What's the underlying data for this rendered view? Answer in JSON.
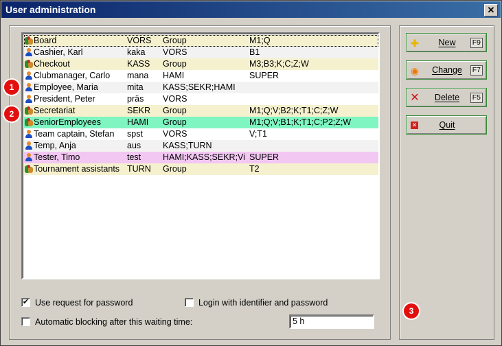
{
  "window": {
    "title": "User administration",
    "close_label": "✕"
  },
  "users": [
    {
      "name": "Board",
      "id": "VORS",
      "type": "Group",
      "rights": "M1;Q",
      "icon": "group-icon",
      "style": "group sel"
    },
    {
      "name": "Cashier, Karl",
      "id": "kaka",
      "type": "VORS",
      "rights": "B1",
      "icon": "person-icon",
      "style": "alt"
    },
    {
      "name": "Checkout",
      "id": "KASS",
      "type": "Group",
      "rights": "M3;B3;K;C;Z;W",
      "icon": "group-icon",
      "style": "group"
    },
    {
      "name": "Clubmanager, Carlo",
      "id": "mana",
      "type": "HAMI",
      "rights": "SUPER",
      "icon": "person-icon",
      "style": ""
    },
    {
      "name": "Employee, Maria",
      "id": "mita",
      "type": "KASS;SEKR;HAMI",
      "rights": "",
      "icon": "person-icon",
      "style": "alt"
    },
    {
      "name": "President, Peter",
      "id": "präs",
      "type": "VORS",
      "rights": "",
      "icon": "person-icon",
      "style": ""
    },
    {
      "name": "Secretariat",
      "id": "SEKR",
      "type": "Group",
      "rights": "M1;Q;V;B2;K;T1;C;Z;W",
      "icon": "group-icon",
      "style": "group"
    },
    {
      "name": "SeniorEmployees",
      "id": "HAMI",
      "type": "Group",
      "rights": "M1;Q;V;B1;K;T1;C;P2;Z;W",
      "icon": "group-icon",
      "style": "green"
    },
    {
      "name": "Team captain, Stefan",
      "id": "spst",
      "type": "VORS",
      "rights": "V;T1",
      "icon": "person-icon",
      "style": ""
    },
    {
      "name": "Temp, Anja",
      "id": "aus",
      "type": "KASS;TURN",
      "rights": "",
      "icon": "person-icon",
      "style": "alt"
    },
    {
      "name": "Tester, Timo",
      "id": "test",
      "type": "HAMI;KASS;SEKR;Vi",
      "rights": "SUPER",
      "icon": "person-icon",
      "style": "pink"
    },
    {
      "name": "Tournament assistants",
      "id": "TURN",
      "type": "Group",
      "rights": "T2",
      "icon": "group-icon",
      "style": "group"
    }
  ],
  "badges": [
    "1",
    "2",
    "3"
  ],
  "options": {
    "use_request_label": "Use request for password",
    "use_request_checked": true,
    "login_identifier_label": "Login with identifier and password",
    "login_identifier_checked": false,
    "auto_block_label": "Automatic blocking after this waiting time:",
    "auto_block_checked": false,
    "waiting_time": "5 h"
  },
  "buttons": [
    {
      "label": "New",
      "key": "F9",
      "icon": "new-icon"
    },
    {
      "label": "Change",
      "key": "F7",
      "icon": "change-icon"
    },
    {
      "label": "Delete",
      "key": "F5",
      "icon": "delete-icon"
    },
    {
      "label": "Quit",
      "key": "",
      "icon": "quit-icon"
    }
  ]
}
